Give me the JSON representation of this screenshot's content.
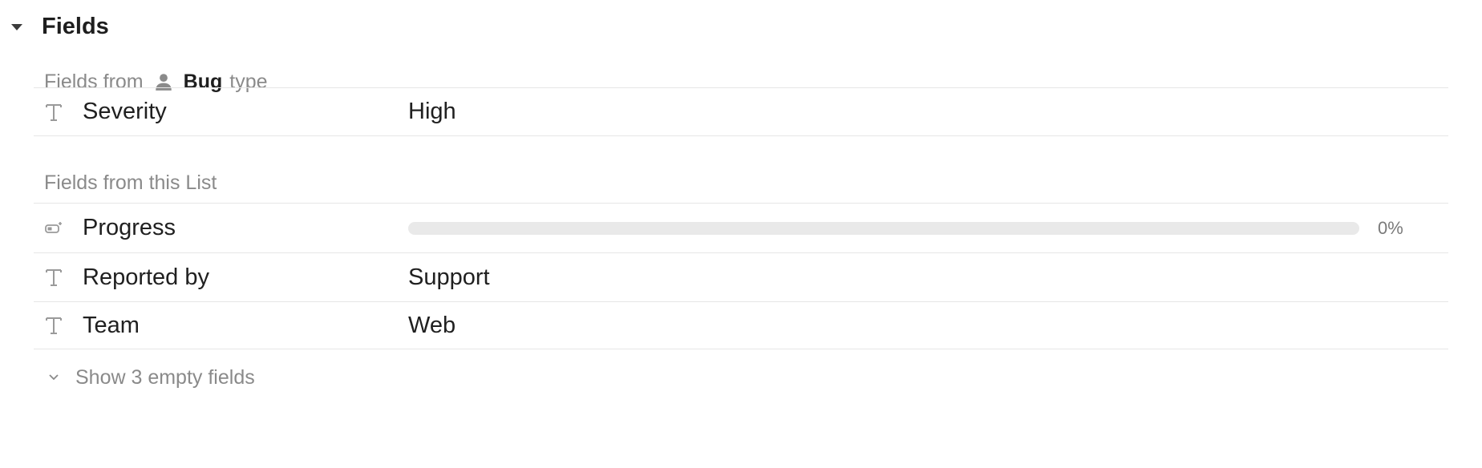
{
  "section": {
    "title": "Fields"
  },
  "groups": {
    "type_fields": {
      "prefix": "Fields from",
      "type_name": "Bug",
      "suffix": "type",
      "icon": "person-icon"
    },
    "list_fields": {
      "label": "Fields from this List"
    }
  },
  "fields": {
    "severity": {
      "name": "Severity",
      "value": "High",
      "icon": "text-type-icon"
    },
    "progress": {
      "name": "Progress",
      "percent": 0,
      "percent_label": "0%",
      "icon": "progress-icon"
    },
    "reported_by": {
      "name": "Reported by",
      "value": "Support",
      "icon": "text-type-icon"
    },
    "team": {
      "name": "Team",
      "value": "Web",
      "icon": "text-type-icon"
    }
  },
  "show_empty": {
    "label": "Show 3 empty fields",
    "icon": "chevron-down-icon"
  },
  "colors": {
    "progress_track": "#e9e9e9",
    "progress_fill": "#7b68ee",
    "divider": "#e6e6e6",
    "muted_text": "#8a8a8a"
  }
}
